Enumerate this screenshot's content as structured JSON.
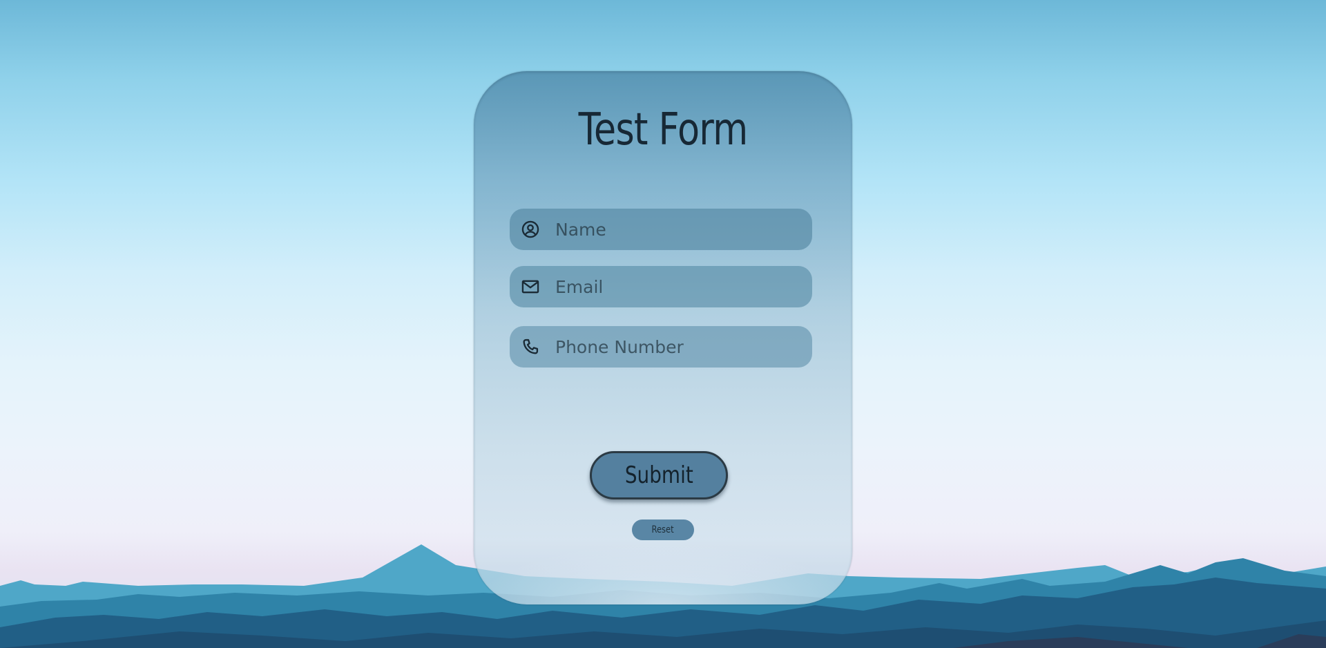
{
  "form": {
    "title": "Test Form",
    "fields": [
      {
        "icon": "user-circle-icon",
        "placeholder": "Name",
        "value": ""
      },
      {
        "icon": "mail-icon",
        "placeholder": "Email",
        "value": ""
      },
      {
        "icon": "phone-icon",
        "placeholder": "Phone Number",
        "value": ""
      }
    ],
    "submit_label": "Submit",
    "reset_label": "Reset"
  },
  "colors": {
    "card_top": "#5692b2",
    "field_bg": "#5084a0",
    "submit_bg": "#54809f",
    "reset_bg": "#5986a5",
    "text_dark": "#172835"
  }
}
